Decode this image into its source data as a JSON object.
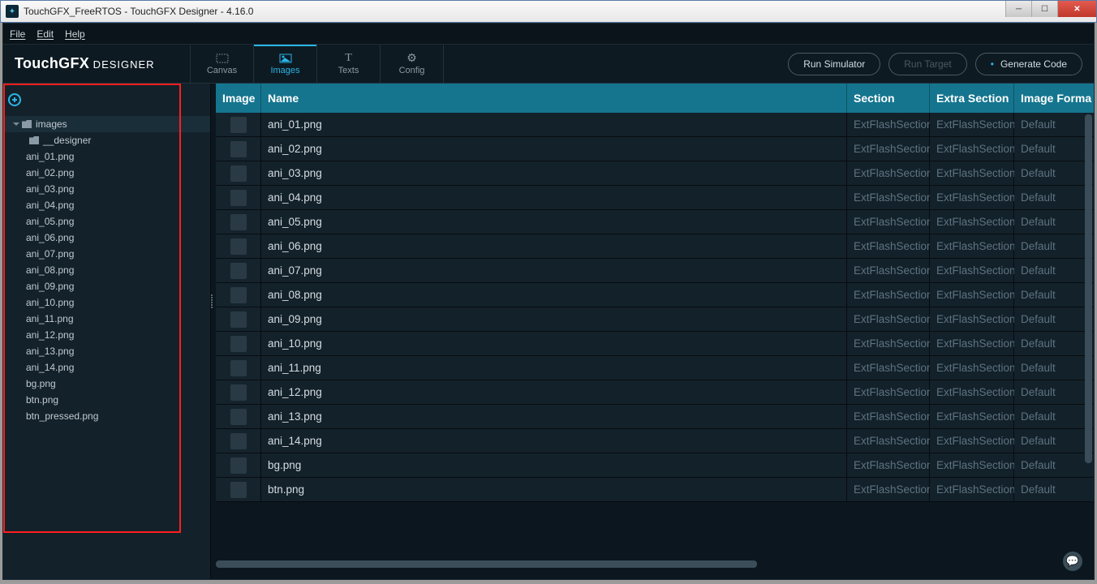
{
  "window": {
    "title": "TouchGFX_FreeRTOS - TouchGFX Designer - 4.16.0"
  },
  "menus": {
    "file": "File",
    "edit": "Edit",
    "help": "Help"
  },
  "logo": {
    "brand": "TouchGFX",
    "suffix": " DESIGNER"
  },
  "tabs": {
    "canvas": "Canvas",
    "images": "Images",
    "texts": "Texts",
    "config": "Config"
  },
  "rbuttons": {
    "sim": "Run Simulator",
    "target": "Run Target",
    "gen": "Generate Code"
  },
  "tree": {
    "root": "images",
    "designer": "__designer",
    "files": [
      "ani_01.png",
      "ani_02.png",
      "ani_03.png",
      "ani_04.png",
      "ani_05.png",
      "ani_06.png",
      "ani_07.png",
      "ani_08.png",
      "ani_09.png",
      "ani_10.png",
      "ani_11.png",
      "ani_12.png",
      "ani_13.png",
      "ani_14.png",
      "bg.png",
      "btn.png",
      "btn_pressed.png"
    ]
  },
  "table": {
    "headers": {
      "image": "Image",
      "name": "Name",
      "section": "Section",
      "extra": "Extra Section",
      "format": "Image Forma"
    },
    "rows": [
      {
        "name": "ani_01.png",
        "section": "ExtFlashSection",
        "extra": "ExtFlashSection",
        "format": "Default"
      },
      {
        "name": "ani_02.png",
        "section": "ExtFlashSection",
        "extra": "ExtFlashSection",
        "format": "Default"
      },
      {
        "name": "ani_03.png",
        "section": "ExtFlashSection",
        "extra": "ExtFlashSection",
        "format": "Default"
      },
      {
        "name": "ani_04.png",
        "section": "ExtFlashSection",
        "extra": "ExtFlashSection",
        "format": "Default"
      },
      {
        "name": "ani_05.png",
        "section": "ExtFlashSection",
        "extra": "ExtFlashSection",
        "format": "Default"
      },
      {
        "name": "ani_06.png",
        "section": "ExtFlashSection",
        "extra": "ExtFlashSection",
        "format": "Default"
      },
      {
        "name": "ani_07.png",
        "section": "ExtFlashSection",
        "extra": "ExtFlashSection",
        "format": "Default"
      },
      {
        "name": "ani_08.png",
        "section": "ExtFlashSection",
        "extra": "ExtFlashSection",
        "format": "Default"
      },
      {
        "name": "ani_09.png",
        "section": "ExtFlashSection",
        "extra": "ExtFlashSection",
        "format": "Default"
      },
      {
        "name": "ani_10.png",
        "section": "ExtFlashSection",
        "extra": "ExtFlashSection",
        "format": "Default"
      },
      {
        "name": "ani_11.png",
        "section": "ExtFlashSection",
        "extra": "ExtFlashSection",
        "format": "Default"
      },
      {
        "name": "ani_12.png",
        "section": "ExtFlashSection",
        "extra": "ExtFlashSection",
        "format": "Default"
      },
      {
        "name": "ani_13.png",
        "section": "ExtFlashSection",
        "extra": "ExtFlashSection",
        "format": "Default"
      },
      {
        "name": "ani_14.png",
        "section": "ExtFlashSection",
        "extra": "ExtFlashSection",
        "format": "Default"
      },
      {
        "name": "bg.png",
        "section": "ExtFlashSection",
        "extra": "ExtFlashSection",
        "format": "Default"
      },
      {
        "name": "btn.png",
        "section": "ExtFlashSection",
        "extra": "ExtFlashSection",
        "format": "Default"
      }
    ]
  }
}
